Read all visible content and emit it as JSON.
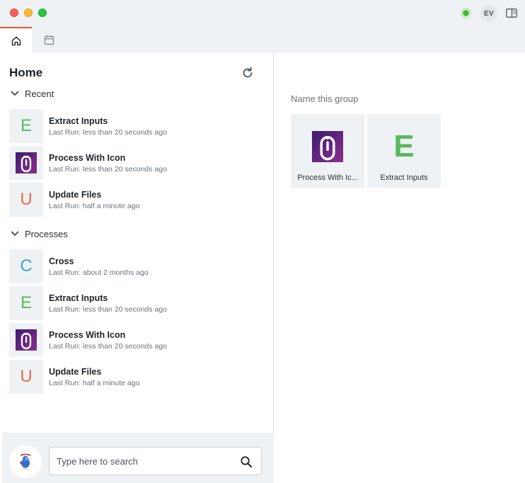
{
  "window": {
    "user_initials": "EV"
  },
  "tabs": [
    {
      "icon": "home-icon",
      "active": true
    },
    {
      "icon": "calendar-icon",
      "active": false
    }
  ],
  "home": {
    "title": "Home",
    "sections": {
      "recent": {
        "label": "Recent",
        "items": [
          {
            "name": "Extract Inputs",
            "last_run": "Last Run: less than 20 seconds ago",
            "thumb": "E",
            "color": "#5cb85c"
          },
          {
            "name": "Process With Icon",
            "last_run": "Last Run: less than 20 seconds ago",
            "thumb": "logo",
            "color": "#6a2a8a"
          },
          {
            "name": "Update Files",
            "last_run": "Last Run: half a minute ago",
            "thumb": "U",
            "color": "#e8694a"
          }
        ]
      },
      "processes": {
        "label": "Processes",
        "items": [
          {
            "name": "Cross",
            "last_run": "Last Run: about 2 months ago",
            "thumb": "C",
            "color": "#3aa8d8"
          },
          {
            "name": "Extract Inputs",
            "last_run": "Last Run: less than 20 seconds ago",
            "thumb": "E",
            "color": "#5cb85c"
          },
          {
            "name": "Process With Icon",
            "last_run": "Last Run: less than 20 seconds ago",
            "thumb": "logo",
            "color": "#6a2a8a"
          },
          {
            "name": "Update Files",
            "last_run": "Last Run: half a minute ago",
            "thumb": "U",
            "color": "#e8694a"
          }
        ]
      }
    }
  },
  "search": {
    "placeholder": "Type here to search"
  },
  "group": {
    "name_placeholder": "Name this group",
    "tiles": [
      {
        "label": "Process With Ic...",
        "thumb": "logo"
      },
      {
        "label": "Extract Inputs",
        "thumb": "E",
        "color": "#5cb85c"
      }
    ]
  },
  "colors": {
    "accent": "#e8542a",
    "status_online": "#44bb34",
    "panel_bg": "#eef2f5"
  }
}
